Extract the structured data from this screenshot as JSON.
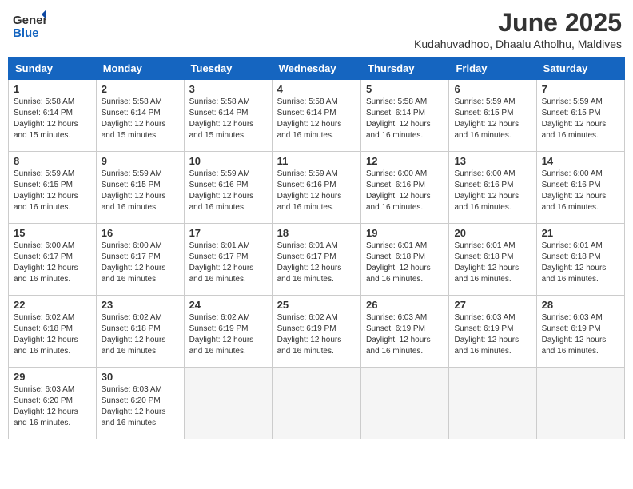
{
  "header": {
    "logo_general": "General",
    "logo_blue": "Blue",
    "title": "June 2025",
    "subtitle": "Kudahuvadhoo, Dhaalu Atholhu, Maldives"
  },
  "weekdays": [
    "Sunday",
    "Monday",
    "Tuesday",
    "Wednesday",
    "Thursday",
    "Friday",
    "Saturday"
  ],
  "weeks": [
    [
      {
        "day": "1",
        "info": "Sunrise: 5:58 AM\nSunset: 6:14 PM\nDaylight: 12 hours\nand 15 minutes."
      },
      {
        "day": "2",
        "info": "Sunrise: 5:58 AM\nSunset: 6:14 PM\nDaylight: 12 hours\nand 15 minutes."
      },
      {
        "day": "3",
        "info": "Sunrise: 5:58 AM\nSunset: 6:14 PM\nDaylight: 12 hours\nand 15 minutes."
      },
      {
        "day": "4",
        "info": "Sunrise: 5:58 AM\nSunset: 6:14 PM\nDaylight: 12 hours\nand 16 minutes."
      },
      {
        "day": "5",
        "info": "Sunrise: 5:58 AM\nSunset: 6:14 PM\nDaylight: 12 hours\nand 16 minutes."
      },
      {
        "day": "6",
        "info": "Sunrise: 5:59 AM\nSunset: 6:15 PM\nDaylight: 12 hours\nand 16 minutes."
      },
      {
        "day": "7",
        "info": "Sunrise: 5:59 AM\nSunset: 6:15 PM\nDaylight: 12 hours\nand 16 minutes."
      }
    ],
    [
      {
        "day": "8",
        "info": "Sunrise: 5:59 AM\nSunset: 6:15 PM\nDaylight: 12 hours\nand 16 minutes."
      },
      {
        "day": "9",
        "info": "Sunrise: 5:59 AM\nSunset: 6:15 PM\nDaylight: 12 hours\nand 16 minutes."
      },
      {
        "day": "10",
        "info": "Sunrise: 5:59 AM\nSunset: 6:16 PM\nDaylight: 12 hours\nand 16 minutes."
      },
      {
        "day": "11",
        "info": "Sunrise: 5:59 AM\nSunset: 6:16 PM\nDaylight: 12 hours\nand 16 minutes."
      },
      {
        "day": "12",
        "info": "Sunrise: 6:00 AM\nSunset: 6:16 PM\nDaylight: 12 hours\nand 16 minutes."
      },
      {
        "day": "13",
        "info": "Sunrise: 6:00 AM\nSunset: 6:16 PM\nDaylight: 12 hours\nand 16 minutes."
      },
      {
        "day": "14",
        "info": "Sunrise: 6:00 AM\nSunset: 6:16 PM\nDaylight: 12 hours\nand 16 minutes."
      }
    ],
    [
      {
        "day": "15",
        "info": "Sunrise: 6:00 AM\nSunset: 6:17 PM\nDaylight: 12 hours\nand 16 minutes."
      },
      {
        "day": "16",
        "info": "Sunrise: 6:00 AM\nSunset: 6:17 PM\nDaylight: 12 hours\nand 16 minutes."
      },
      {
        "day": "17",
        "info": "Sunrise: 6:01 AM\nSunset: 6:17 PM\nDaylight: 12 hours\nand 16 minutes."
      },
      {
        "day": "18",
        "info": "Sunrise: 6:01 AM\nSunset: 6:17 PM\nDaylight: 12 hours\nand 16 minutes."
      },
      {
        "day": "19",
        "info": "Sunrise: 6:01 AM\nSunset: 6:18 PM\nDaylight: 12 hours\nand 16 minutes."
      },
      {
        "day": "20",
        "info": "Sunrise: 6:01 AM\nSunset: 6:18 PM\nDaylight: 12 hours\nand 16 minutes."
      },
      {
        "day": "21",
        "info": "Sunrise: 6:01 AM\nSunset: 6:18 PM\nDaylight: 12 hours\nand 16 minutes."
      }
    ],
    [
      {
        "day": "22",
        "info": "Sunrise: 6:02 AM\nSunset: 6:18 PM\nDaylight: 12 hours\nand 16 minutes."
      },
      {
        "day": "23",
        "info": "Sunrise: 6:02 AM\nSunset: 6:18 PM\nDaylight: 12 hours\nand 16 minutes."
      },
      {
        "day": "24",
        "info": "Sunrise: 6:02 AM\nSunset: 6:19 PM\nDaylight: 12 hours\nand 16 minutes."
      },
      {
        "day": "25",
        "info": "Sunrise: 6:02 AM\nSunset: 6:19 PM\nDaylight: 12 hours\nand 16 minutes."
      },
      {
        "day": "26",
        "info": "Sunrise: 6:03 AM\nSunset: 6:19 PM\nDaylight: 12 hours\nand 16 minutes."
      },
      {
        "day": "27",
        "info": "Sunrise: 6:03 AM\nSunset: 6:19 PM\nDaylight: 12 hours\nand 16 minutes."
      },
      {
        "day": "28",
        "info": "Sunrise: 6:03 AM\nSunset: 6:19 PM\nDaylight: 12 hours\nand 16 minutes."
      }
    ],
    [
      {
        "day": "29",
        "info": "Sunrise: 6:03 AM\nSunset: 6:20 PM\nDaylight: 12 hours\nand 16 minutes."
      },
      {
        "day": "30",
        "info": "Sunrise: 6:03 AM\nSunset: 6:20 PM\nDaylight: 12 hours\nand 16 minutes."
      },
      {
        "day": "",
        "info": ""
      },
      {
        "day": "",
        "info": ""
      },
      {
        "day": "",
        "info": ""
      },
      {
        "day": "",
        "info": ""
      },
      {
        "day": "",
        "info": ""
      }
    ]
  ]
}
